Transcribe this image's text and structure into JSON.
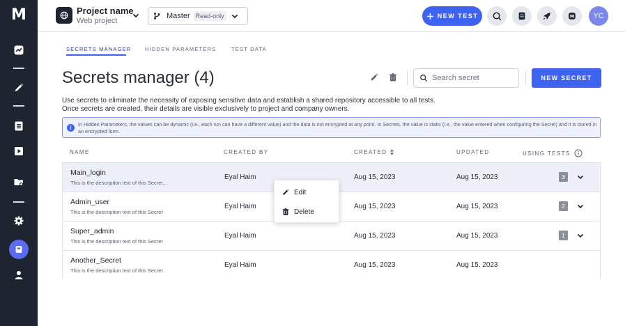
{
  "sidebar": {
    "logo": "M",
    "icons": [
      "dashboard-icon",
      "pencil-icon",
      "tests-list-icon",
      "play-icon",
      "folder-settings-icon",
      "gear-icon",
      "secrets-icon",
      "user-icon"
    ]
  },
  "topbar": {
    "project_name": "Project name",
    "project_sub": "Web project",
    "branch_name": "Master",
    "branch_badge": "Read-only",
    "new_test_label": "NEW TEST",
    "avatar_initials": "YC"
  },
  "tabs": [
    {
      "label": "SECRETS MANAGER",
      "active": true
    },
    {
      "label": "HIDDEN PARAMETERS",
      "active": false
    },
    {
      "label": "TEST DATA",
      "active": false
    }
  ],
  "page": {
    "title": "Secrets manager (4)",
    "search_placeholder": "Search secret",
    "new_secret_label": "NEW SECRET",
    "desc_line1": "Use secrets to eliminate the necessity of exposing sensitive data and establish a shared repository accessible to all tests.",
    "desc_line2": "Once secrets are created, their details are visible exclusively to project and company owners.",
    "info_text": "In Hidden Parameters, the values can be dynamic (i.e., each run can have a different value) and the data is not encrypted at any point. In Secrets, the value is static (i.e., the value entered when configuring the Secret) and it is stored in an encrypted form."
  },
  "table": {
    "headers": {
      "name": "NAME",
      "created_by": "CREATED BY",
      "created": "CREATED",
      "updated": "UPDATED",
      "using_tests": "USING TESTS"
    },
    "rows": [
      {
        "name": "Main_login",
        "desc": "This is the description text of this Secret...",
        "created_by": "Eyal Haim",
        "created": "Aug 15, 2023",
        "updated": "Aug 15, 2023",
        "using_tests": "3"
      },
      {
        "name": "Admin_user",
        "desc": "This is the description text of this Secret",
        "created_by": "Eyal Haim",
        "created": "Aug 15, 2023",
        "updated": "Aug 15, 2023",
        "using_tests": "2"
      },
      {
        "name": "Super_admin",
        "desc": "This is the description text of this Secret",
        "created_by": "Eyal Haim",
        "created": "Aug 15, 2023",
        "updated": "Aug 15, 2023",
        "using_tests": "1"
      },
      {
        "name": "Another_Secret",
        "desc": "This is the description text of this Secret",
        "created_by": "Eyal Haim",
        "created": "Aug 15, 2023",
        "updated": "Aug 15, 2023",
        "using_tests": ""
      }
    ]
  },
  "context_menu": {
    "edit_label": "Edit",
    "delete_label": "Delete"
  },
  "colors": {
    "sidebar_bg": "#1e2430",
    "accent": "#3d63f0",
    "active_nav": "#5b6cf0",
    "avatar": "#7c87ee",
    "info_bg": "#eef1fb",
    "row_hover": "#edf0f9"
  }
}
